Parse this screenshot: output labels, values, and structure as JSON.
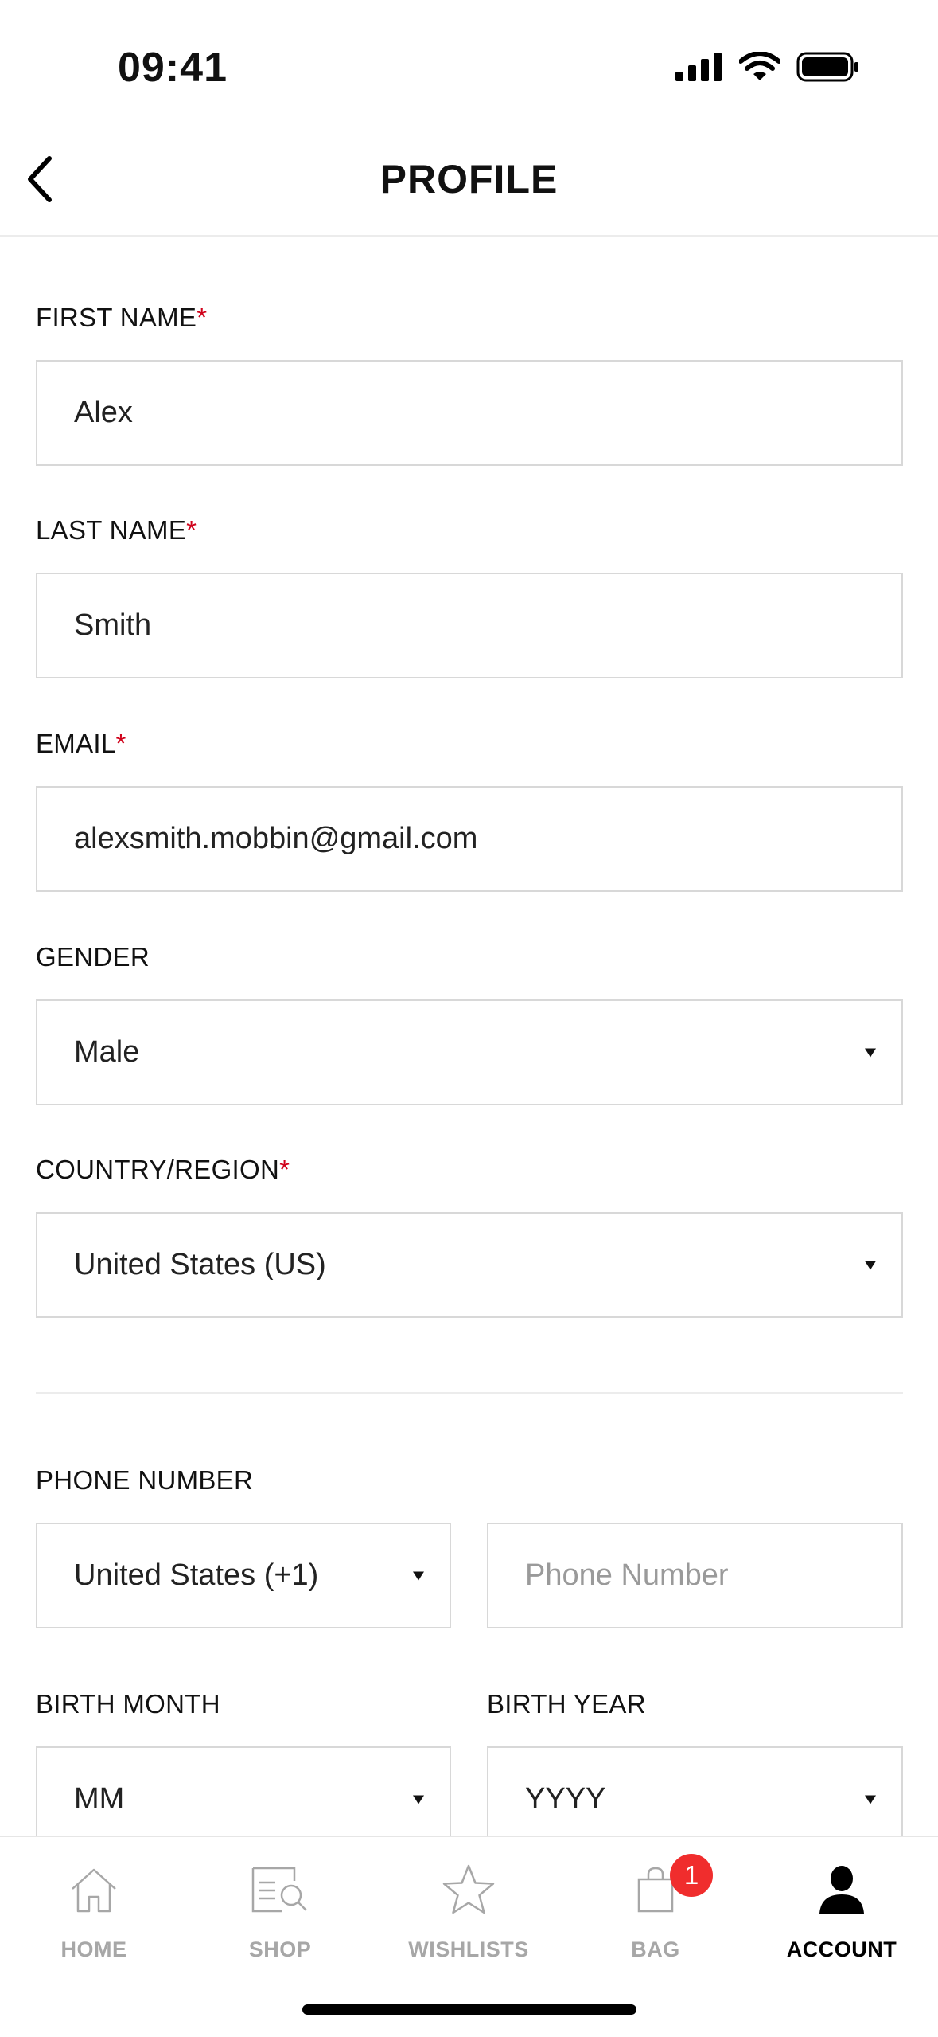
{
  "status_bar": {
    "time": "09:41"
  },
  "header": {
    "title": "PROFILE"
  },
  "form": {
    "first_name": {
      "label": "FIRST NAME",
      "required_mark": "*",
      "value": "Alex"
    },
    "last_name": {
      "label": "LAST NAME",
      "required_mark": "*",
      "value": "Smith"
    },
    "email": {
      "label": "EMAIL",
      "required_mark": "*",
      "value": "alexsmith.mobbin@gmail.com"
    },
    "gender": {
      "label": "GENDER",
      "value": "Male"
    },
    "country": {
      "label": "COUNTRY/REGION",
      "required_mark": "*",
      "value": "United States (US)"
    },
    "phone": {
      "label": "PHONE NUMBER",
      "country_code": "United States (+1)",
      "placeholder": "Phone Number"
    },
    "birth_month": {
      "label": "BIRTH MONTH",
      "value": "MM"
    },
    "birth_year": {
      "label": "BIRTH YEAR",
      "value": "YYYY"
    }
  },
  "tab_bar": {
    "items": [
      {
        "label": "HOME",
        "icon": "home-icon"
      },
      {
        "label": "SHOP",
        "icon": "shop-search-icon"
      },
      {
        "label": "WISHLISTS",
        "icon": "star-icon"
      },
      {
        "label": "BAG",
        "icon": "bag-icon",
        "badge": "1"
      },
      {
        "label": "ACCOUNT",
        "icon": "person-icon",
        "active": true
      }
    ]
  },
  "colors": {
    "required": "#d0021b",
    "badge": "#f02d2d",
    "inactive_tab": "#a7a7a7",
    "active_tab": "#000000"
  }
}
